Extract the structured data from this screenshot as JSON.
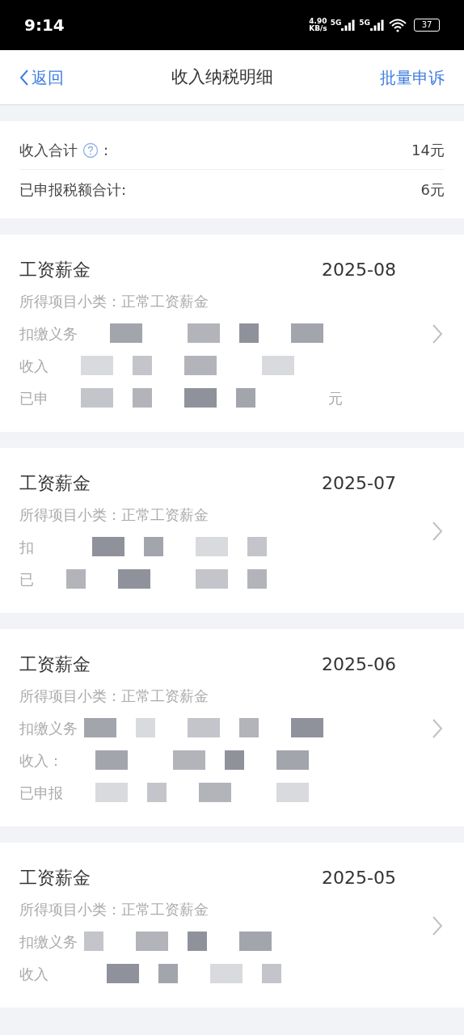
{
  "status_bar": {
    "time": "9:14",
    "speed_value": "4.90",
    "speed_unit": "KB/s",
    "network_1": "5G",
    "network_2": "5G",
    "battery": "37"
  },
  "nav": {
    "back": "返回",
    "title": "收入纳税明细",
    "action": "批量申诉"
  },
  "summary": [
    {
      "label": "收入合计",
      "help": true,
      "colon": ":",
      "value": "14元"
    },
    {
      "label": "已申报税额合计:",
      "help": false,
      "value": "6元"
    }
  ],
  "records": [
    {
      "category": "工资薪金",
      "period": "2025-08",
      "subtype": "所得项目小类：正常工资薪金",
      "lines": [
        {
          "label": "扣缴义务"
        },
        {
          "label": "收入"
        },
        {
          "label": "已申",
          "suffix": "元"
        }
      ]
    },
    {
      "category": "工资薪金",
      "period": "2025-07",
      "subtype": "所得项目小类：正常工资薪金",
      "lines": [
        {
          "label": "扣"
        },
        {
          "label": "已"
        }
      ]
    },
    {
      "category": "工资薪金",
      "period": "2025-06",
      "subtype": "所得项目小类：正常工资薪金",
      "lines": [
        {
          "label": "扣缴义务"
        },
        {
          "label": "收入："
        },
        {
          "label": "已申报"
        }
      ]
    },
    {
      "category": "工资薪金",
      "period": "2025-05",
      "subtype": "所得项目小类：正常工资薪金",
      "lines": [
        {
          "label": "扣缴义务"
        },
        {
          "label": "收入"
        }
      ]
    }
  ]
}
